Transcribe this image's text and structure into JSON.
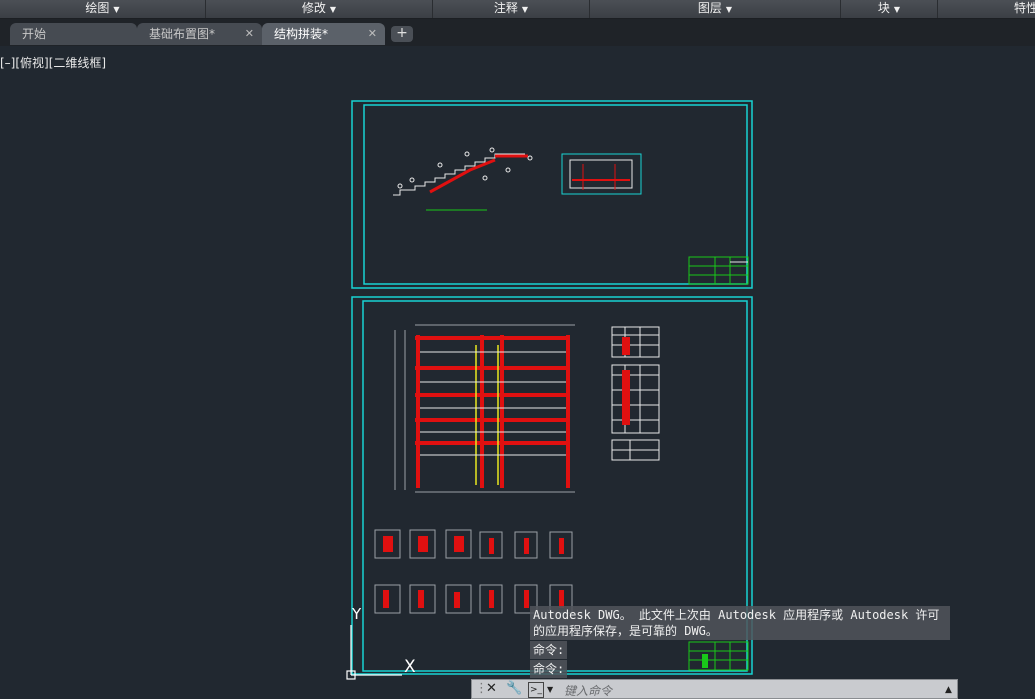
{
  "ribbon": {
    "panels": [
      {
        "label": "绘图"
      },
      {
        "label": "修改"
      },
      {
        "label": "注释"
      },
      {
        "label": "图层"
      },
      {
        "label": "块"
      },
      {
        "label": "特性"
      }
    ]
  },
  "tabs": [
    {
      "label": "开始"
    },
    {
      "label": "基础布置图*",
      "close": "✕"
    },
    {
      "label": "结构拼装*",
      "close": "✕"
    }
  ],
  "add_tab": "+",
  "viewport_label": "[–][俯视][二维线框]",
  "ucs": {
    "y": "Y",
    "x": "X"
  },
  "command_history": [
    "Autodesk DWG。  此文件上次由 Autodesk 应用程序或 Autodesk 许可",
    "的应用程序保存，是可靠的 DWG。",
    "命令:",
    "命令:"
  ],
  "command_line": {
    "placeholder": "键入命令"
  },
  "colors": {
    "frame": "#19d3d3",
    "beam": "#e01010",
    "title_block": "#19c819",
    "background": "#212830"
  }
}
